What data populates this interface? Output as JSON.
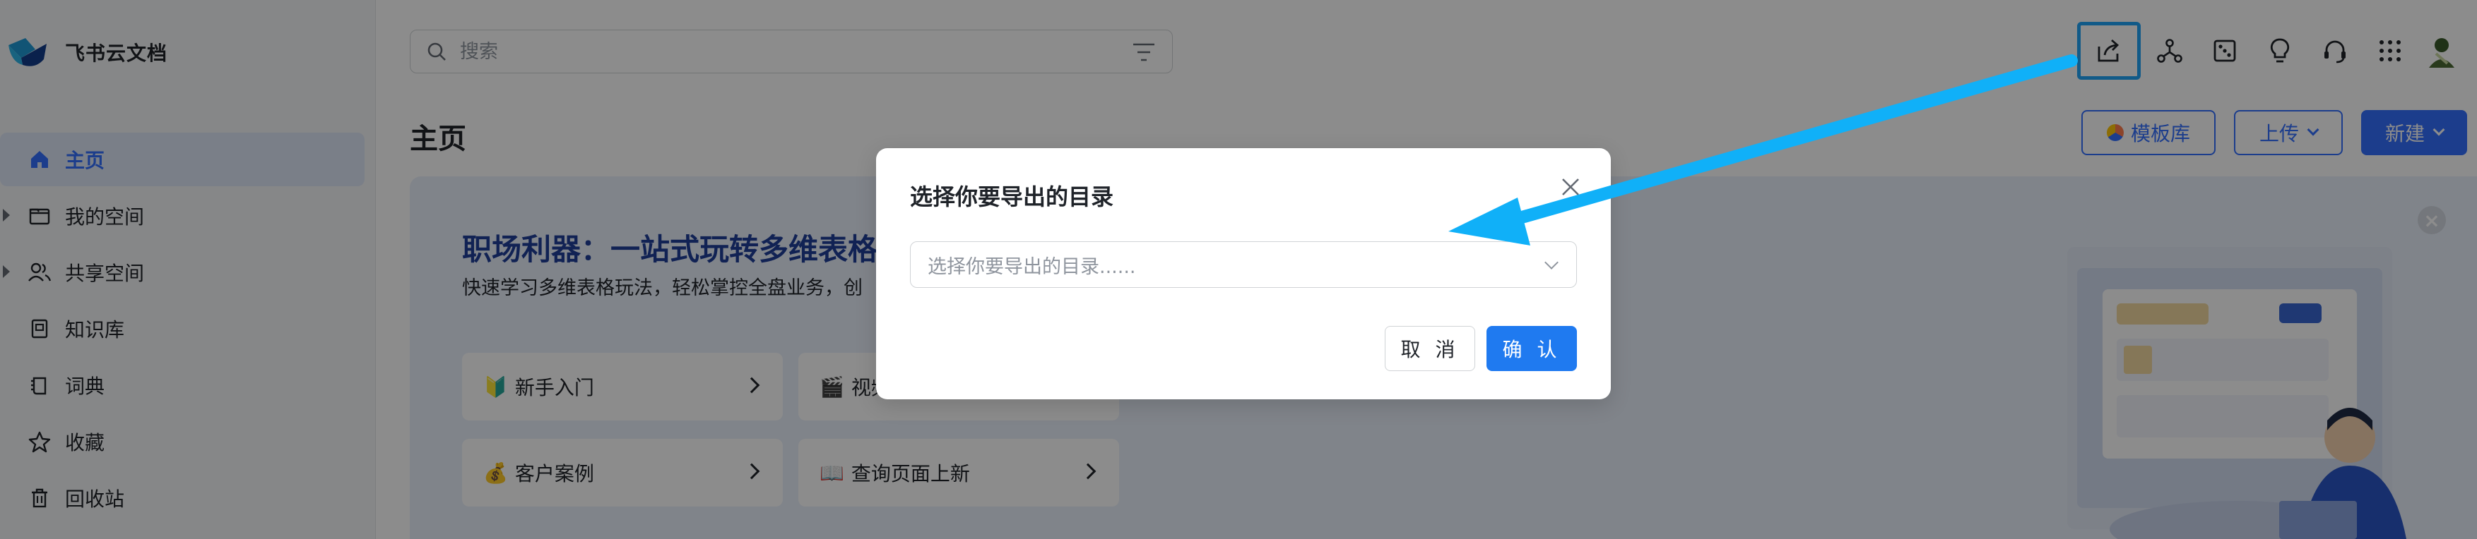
{
  "app": {
    "name": "飞书云文档"
  },
  "sidebar": {
    "items": [
      {
        "label": "主页",
        "icon": "home-icon",
        "active": true
      },
      {
        "label": "我的空间",
        "icon": "folder-icon",
        "expandable": true
      },
      {
        "label": "共享空间",
        "icon": "users-icon",
        "expandable": true
      },
      {
        "label": "知识库",
        "icon": "book-icon"
      },
      {
        "label": "词典",
        "icon": "dictionary-icon"
      },
      {
        "label": "收藏",
        "icon": "star-icon"
      },
      {
        "label": "回收站",
        "icon": "trash-icon"
      }
    ]
  },
  "header": {
    "search_placeholder": "搜索",
    "icons": [
      "share-export-icon",
      "network-icon",
      "dice-icon",
      "lightbulb-icon",
      "headset-icon",
      "apps-grid-icon",
      "avatar"
    ]
  },
  "main": {
    "title": "主页",
    "actions": {
      "template": "模板库",
      "upload": "上传",
      "new": "新建"
    },
    "banner": {
      "title": "职场利器：一站式玩转多维表格",
      "subtitle": "快速学习多维表格玩法，轻松掌控全盘业务，创",
      "cards": [
        {
          "emoji": "🔰",
          "label": "新手入门"
        },
        {
          "emoji": "🎬",
          "label": "视频"
        },
        {
          "emoji": "💰",
          "label": "客户案例"
        },
        {
          "emoji": "📖",
          "label": "查询页面上新"
        }
      ]
    }
  },
  "dialog": {
    "title": "选择你要导出的目录",
    "select_placeholder": "选择你要导出的目录......",
    "cancel": "取 消",
    "confirm": "确 认"
  },
  "colors": {
    "accent": "#3370ff",
    "highlight": "#1fa5f7",
    "confirm": "#1f7af0"
  }
}
